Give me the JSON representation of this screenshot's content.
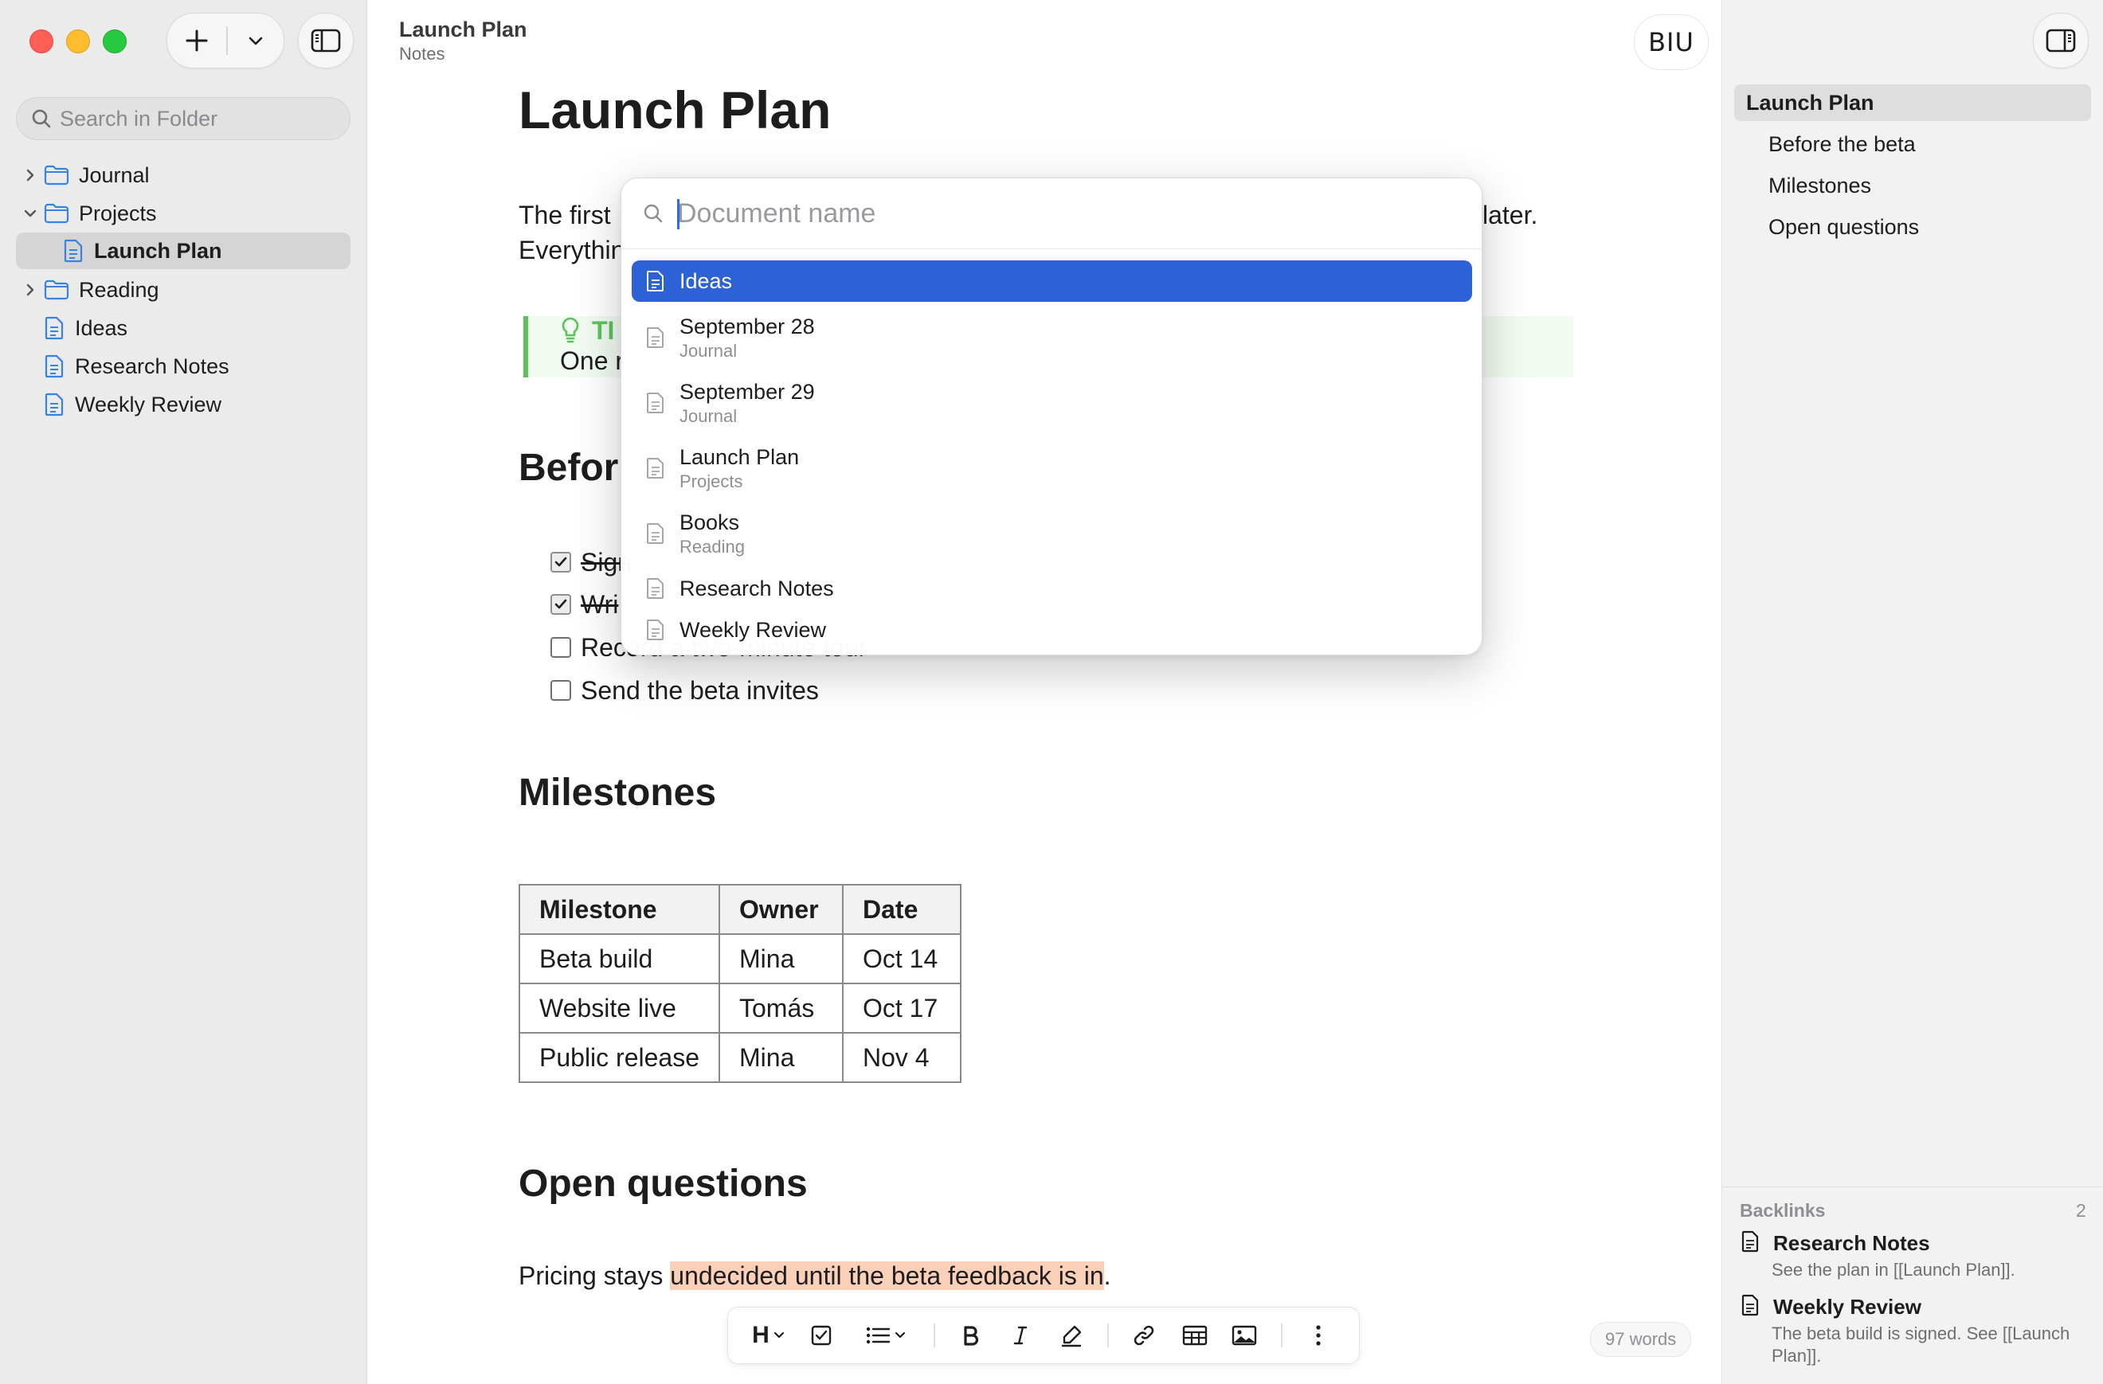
{
  "window": {
    "doc_title": "Launch Plan",
    "doc_location": "Notes"
  },
  "sidebar": {
    "search_placeholder": "Search in Folder",
    "tree": [
      {
        "label": "Journal",
        "type": "folder",
        "expanded": false
      },
      {
        "label": "Projects",
        "type": "folder",
        "expanded": true
      },
      {
        "label": "Launch Plan",
        "type": "file",
        "selected": true
      },
      {
        "label": "Reading",
        "type": "folder",
        "expanded": false
      },
      {
        "label": "Ideas",
        "type": "file"
      },
      {
        "label": "Research Notes",
        "type": "file"
      },
      {
        "label": "Weekly Review",
        "type": "file"
      }
    ]
  },
  "editor": {
    "format_button": "BIU",
    "h1": "Launch Plan",
    "intro_left_1": "The first",
    "intro_right_1": "later.",
    "intro_left_2": "Everythin",
    "tip_label": "TI",
    "tip_text": "One r",
    "section_before": "Befor",
    "checklist": [
      {
        "text": "Sign",
        "checked": true
      },
      {
        "text": "Wri",
        "checked": true
      },
      {
        "text": "Record a two-minute tour",
        "checked": false
      },
      {
        "text": "Send the beta invites",
        "checked": false
      }
    ],
    "section_milestones": "Milestones",
    "table": {
      "headers": [
        "Milestone",
        "Owner",
        "Date"
      ],
      "rows": [
        [
          "Beta build",
          "Mina",
          "Oct 14"
        ],
        [
          "Website live",
          "Tomás",
          "Oct 17"
        ],
        [
          "Public release",
          "Mina",
          "Nov 4"
        ]
      ]
    },
    "section_open": "Open questions",
    "pricing_prefix": "Pricing stays ",
    "pricing_highlight": "undecided until the beta feedback is in",
    "pricing_suffix": ".",
    "word_count": "97 words",
    "toolbar": {
      "heading_label": "H"
    }
  },
  "quick_open": {
    "placeholder": "Document name",
    "results": [
      {
        "name": "Ideas",
        "folder": "",
        "selected": true
      },
      {
        "name": "September 28",
        "folder": "Journal"
      },
      {
        "name": "September 29",
        "folder": "Journal"
      },
      {
        "name": "Launch Plan",
        "folder": "Projects"
      },
      {
        "name": "Books",
        "folder": "Reading"
      },
      {
        "name": "Research Notes",
        "folder": ""
      },
      {
        "name": "Weekly Review",
        "folder": ""
      }
    ]
  },
  "outline": {
    "items": [
      "Launch Plan",
      "Before the beta",
      "Milestones",
      "Open questions"
    ]
  },
  "backlinks": {
    "label": "Backlinks",
    "count": "2",
    "items": [
      {
        "title": "Research Notes",
        "snippet": "See the plan in [[Launch Plan]]."
      },
      {
        "title": "Weekly Review",
        "snippet": "The beta build is signed. See [[Launch Plan]]."
      }
    ]
  },
  "colors": {
    "accent": "#2c62d6",
    "folder_icon": "#3b82e0",
    "tip_green": "#5cc35c",
    "highlight": "#fbd0b8"
  }
}
